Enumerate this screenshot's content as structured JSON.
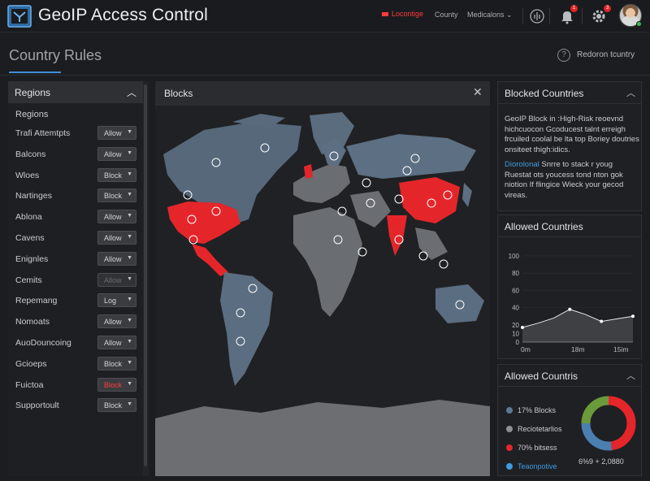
{
  "app": {
    "title": "GeoIP Access Control",
    "logo_icon": "shield-logo-icon",
    "accent": "#3f8fd8",
    "danger": "#ff3b3b"
  },
  "topbar": {
    "location_label": "Locontige",
    "country_menu": "County",
    "notifications_menu": "Medicalons",
    "notification_badge": "1",
    "settings_badge": "3"
  },
  "page": {
    "title": "Country Rules",
    "help_label": "Redoron tcuntry"
  },
  "regions": {
    "title": "Regions",
    "subtitle": "Regions",
    "rules": [
      {
        "name": "Trafi Attemtpts",
        "action": "Allow",
        "style": "normal"
      },
      {
        "name": "Balcons",
        "action": "Allow",
        "style": "normal"
      },
      {
        "name": "Wloes",
        "action": "Block",
        "style": "normal"
      },
      {
        "name": "Nartinges",
        "action": "Block",
        "style": "normal"
      },
      {
        "name": "Ablona",
        "action": "Allow",
        "style": "normal"
      },
      {
        "name": "Cavens",
        "action": "Allow",
        "style": "normal"
      },
      {
        "name": "Enignles",
        "action": "Allow",
        "style": "normal"
      },
      {
        "name": "Cemits",
        "action": "Allow",
        "style": "dim"
      },
      {
        "name": "Repemang",
        "action": "Log",
        "style": "normal"
      },
      {
        "name": "Nomoats",
        "action": "Allow",
        "style": "normal"
      },
      {
        "name": "AuoDouncoing",
        "action": "Allow",
        "style": "normal"
      },
      {
        "name": "Gcioeps",
        "action": "Block",
        "style": "normal"
      },
      {
        "name": "Fuictoa",
        "action": "Block",
        "style": "red"
      },
      {
        "name": "Supportoult",
        "action": "Block",
        "style": "normal"
      }
    ]
  },
  "map": {
    "title": "Blocks"
  },
  "blocked_countries": {
    "title": "Blocked Countries",
    "para1": "GeoIP Block in :High-Risk reoevnd hichcuocon Gcoducest talnt erreigh frcuiled coolal be lta top Boriey doutries onsiteet thigh:idics.",
    "link": "Diorolonal",
    "para2": " Snrre to stack r youg Ruestat ots youcess tond nton gok niotion If flingice Wieck your gecod vireas."
  },
  "allowed_countries": {
    "title": "Allowed Countries",
    "chart_data": {
      "type": "area",
      "x": [
        "0m",
        "18m",
        "15im"
      ],
      "yticks": [
        0,
        10,
        20,
        40,
        60,
        80,
        100
      ],
      "ylim": [
        0,
        100
      ],
      "points": [
        {
          "x": 0,
          "y": 17
        },
        {
          "x": 1,
          "y": 22
        },
        {
          "x": 2,
          "y": 28
        },
        {
          "x": 3,
          "y": 38
        },
        {
          "x": 4,
          "y": 32
        },
        {
          "x": 5,
          "y": 24
        },
        {
          "x": 6,
          "y": 27
        },
        {
          "x": 7,
          "y": 30
        }
      ]
    }
  },
  "allowed_countris": {
    "title": "Allowed Countris",
    "legend": [
      {
        "label": "17% Blocks",
        "color": "#5b7a99"
      },
      {
        "label": "Reciotetarlios",
        "color": "#8d9095"
      },
      {
        "label": "70% bitsess",
        "color": "#e4262a"
      },
      {
        "label": "Teaonpotive",
        "color": "#3f9be0"
      }
    ],
    "donut_label": "6%9 + 2,0880",
    "chart_data": {
      "type": "pie",
      "slices": [
        {
          "name": "red",
          "value": 48,
          "color": "#e4262a"
        },
        {
          "name": "blue",
          "value": 27,
          "color": "#4b7fb0"
        },
        {
          "name": "green",
          "value": 25,
          "color": "#6a9a3a"
        }
      ]
    }
  }
}
